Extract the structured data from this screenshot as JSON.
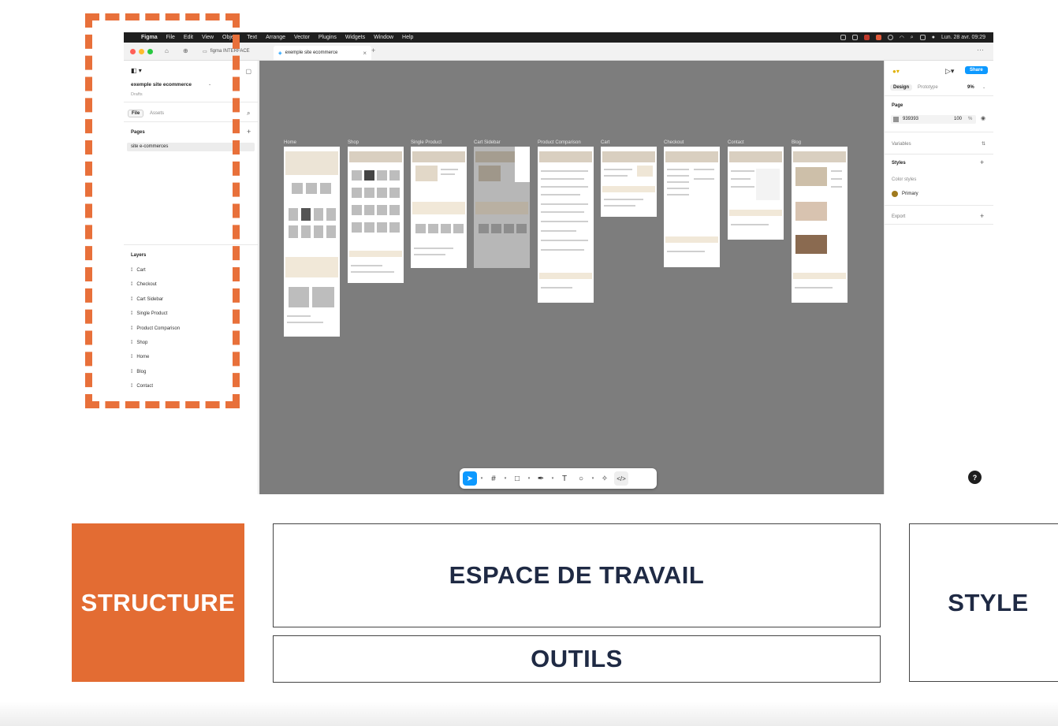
{
  "menubar": {
    "items": [
      "Figma",
      "File",
      "Edit",
      "View",
      "Object",
      "Text",
      "Arrange",
      "Vector",
      "Plugins",
      "Widgets",
      "Window",
      "Help"
    ],
    "datetime": "Lun. 28 avr. 09:29"
  },
  "tabs": [
    {
      "label": "figma INTERFACE"
    },
    {
      "label": "exemple site ecommerce"
    }
  ],
  "left_panel": {
    "file_name": "exemple site ecommerce",
    "file_location": "Drafts",
    "tab_file": "File",
    "tab_assets": "Assets",
    "pages_title": "Pages",
    "page_item": "site e-commerces",
    "layers_title": "Layers",
    "layers": [
      "Cart",
      "Checkout",
      "Cart Sidebar",
      "Single Product",
      "Product Comparison",
      "Shop",
      "Home",
      "Blog",
      "Contact"
    ]
  },
  "canvas": {
    "background_color": "#7d7d7d",
    "frames": [
      {
        "label": "Home"
      },
      {
        "label": "Shop"
      },
      {
        "label": "Single Product"
      },
      {
        "label": "Cart Sidebar"
      },
      {
        "label": "Product Comparison"
      },
      {
        "label": "Cart"
      },
      {
        "label": "Checkout"
      },
      {
        "label": "Contact"
      },
      {
        "label": "Blog"
      }
    ]
  },
  "toolbar": {
    "tools": [
      "move-tool",
      "frame-tool",
      "shape-tool",
      "pen-tool",
      "text-tool",
      "comment-tool",
      "actions-tool",
      "dev-mode-toggle"
    ]
  },
  "right_panel": {
    "share_label": "Share",
    "tab_design": "Design",
    "tab_prototype": "Prototype",
    "zoom": "9%",
    "page_title": "Page",
    "page_color": "939393",
    "page_opacity": "100",
    "page_opacity_unit": "%",
    "variables_title": "Variables",
    "styles_title": "Styles",
    "color_styles_title": "Color styles",
    "color_style_name": "Primary",
    "color_style_swatch": "#a07a1e",
    "export_title": "Export"
  },
  "help_label": "?",
  "legend": {
    "structure": "STRUCTURE",
    "espace": "ESPACE DE TRAVAIL",
    "outils": "OUTILS",
    "style": "STYLE",
    "accent_color": "#e36c33"
  }
}
